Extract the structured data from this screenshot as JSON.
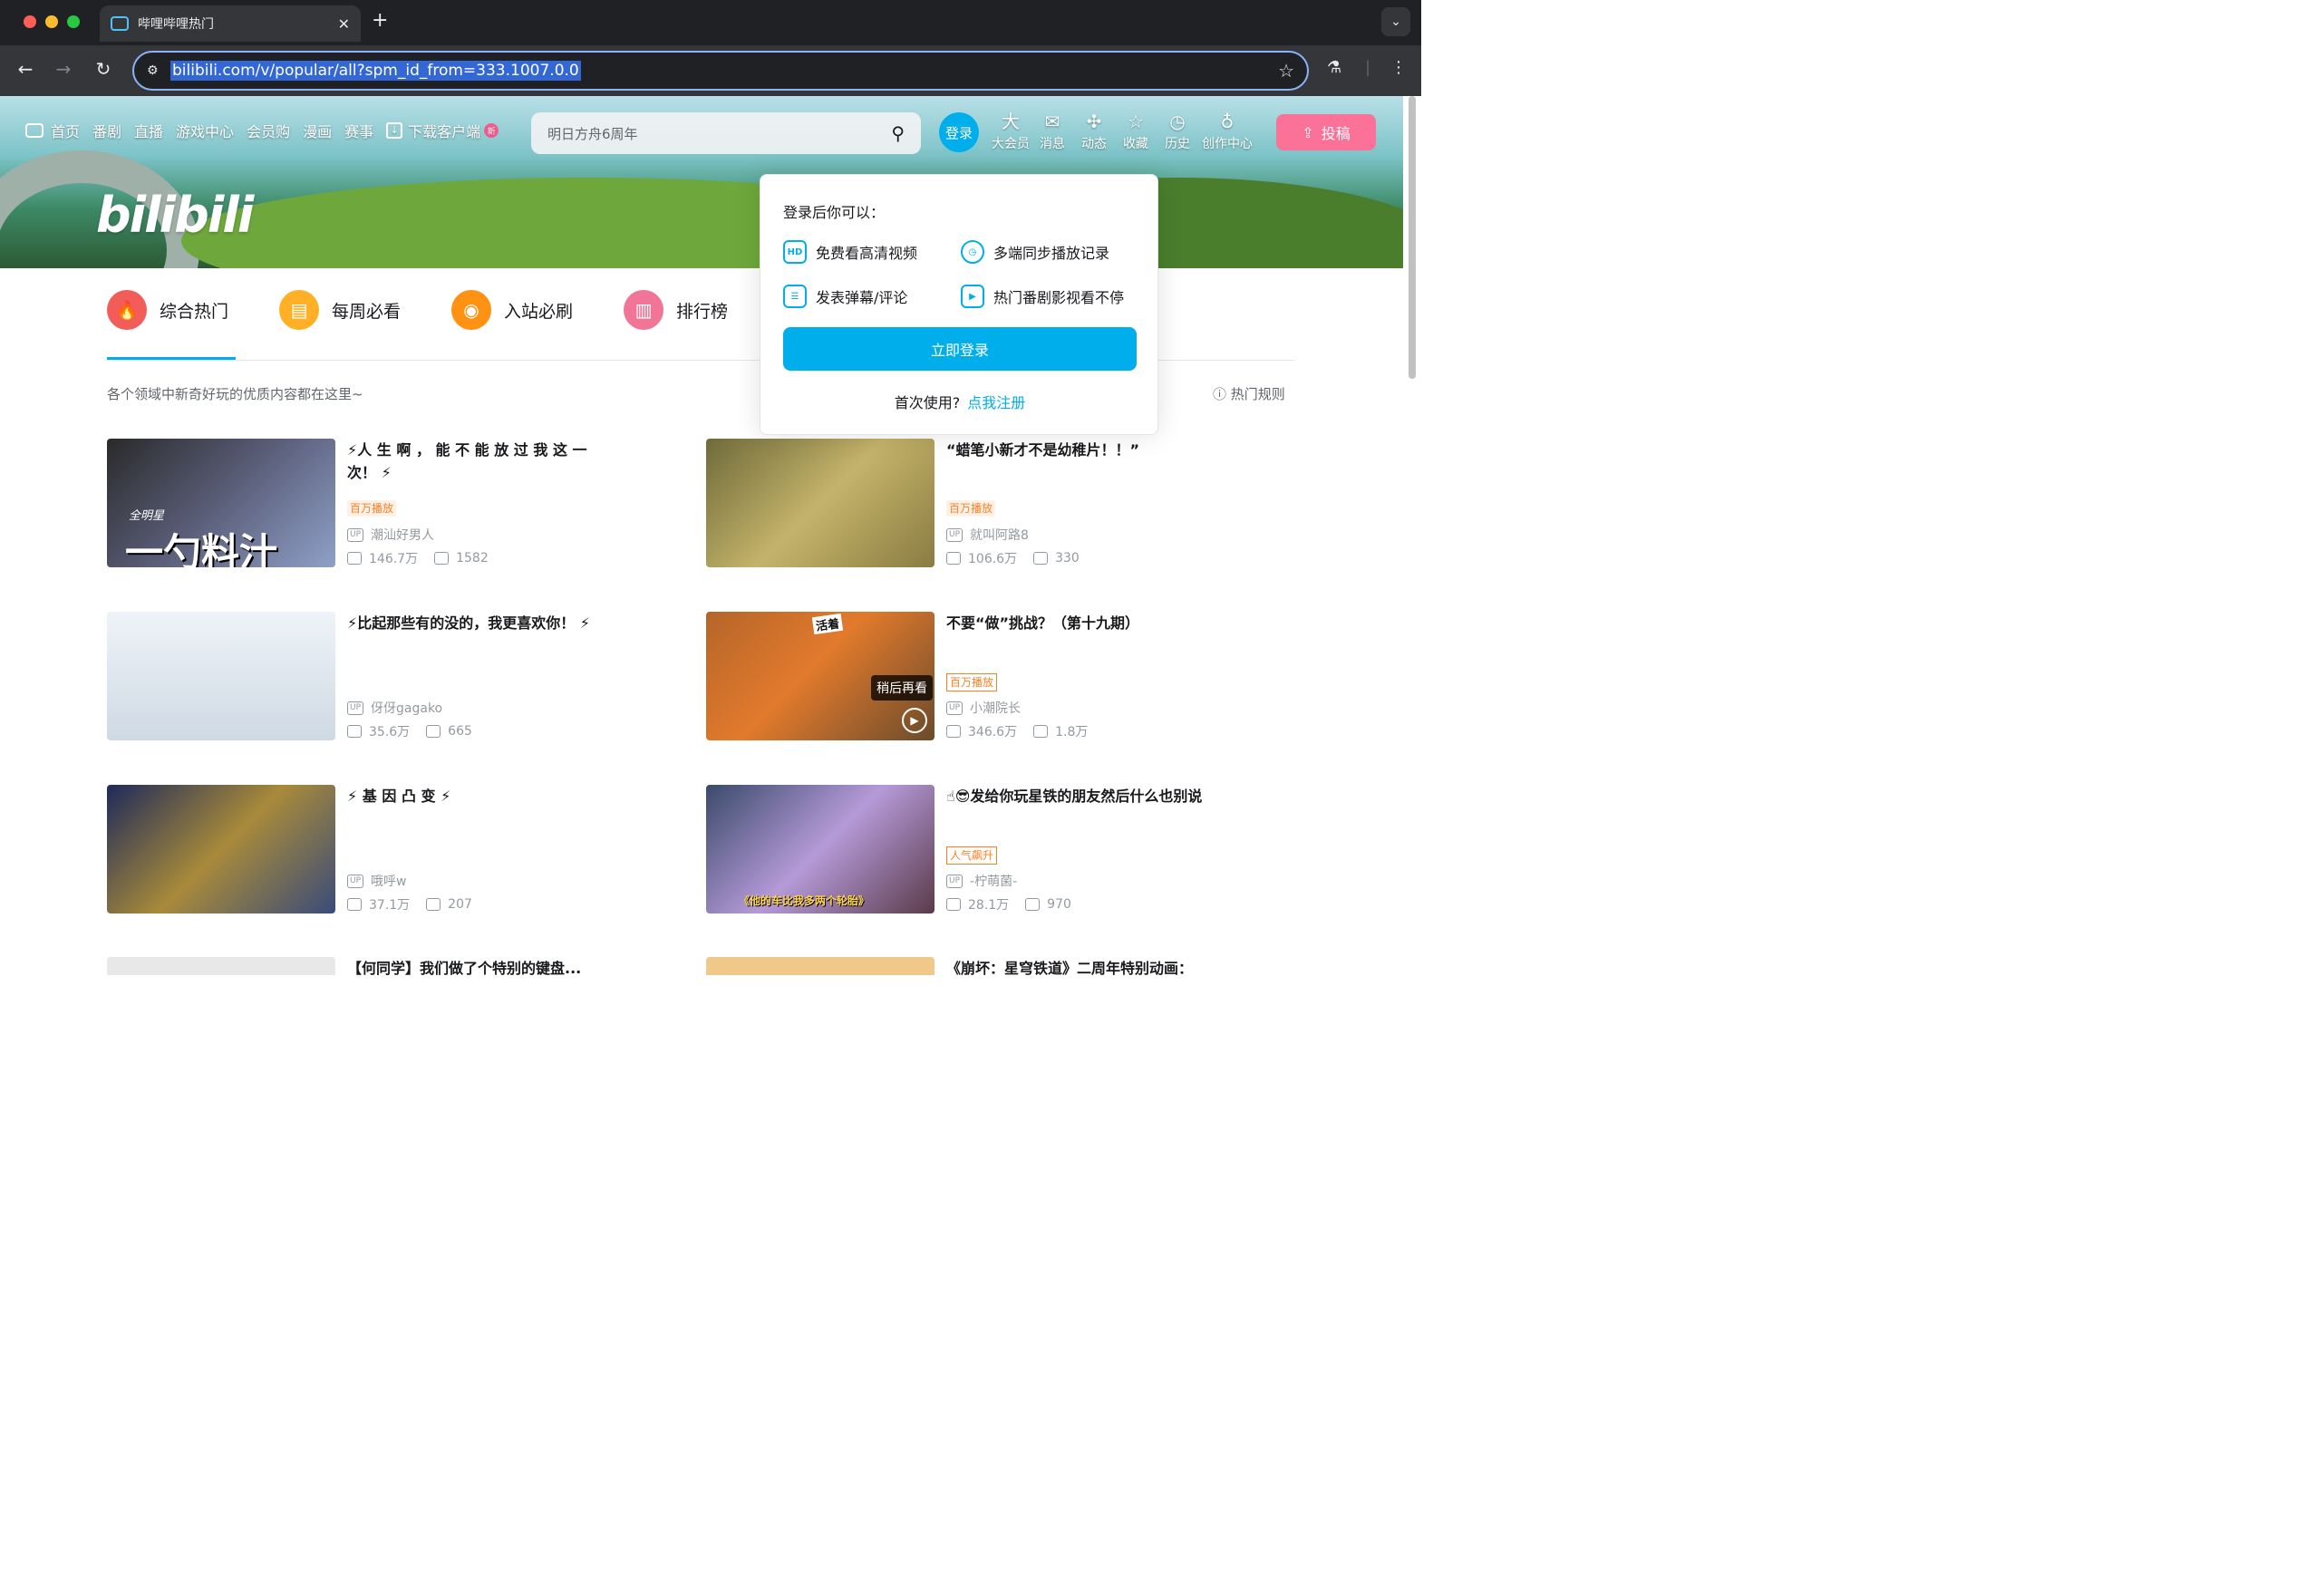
{
  "browser": {
    "tab_title": "哔哩哔哩热门",
    "url": "bilibili.com/v/popular/all?spm_id_from=333.1007.0.0",
    "new_tab": "+",
    "close": "✕",
    "tab_menu": "⌄"
  },
  "header": {
    "logo": "bilibili",
    "nav": [
      "首页",
      "番剧",
      "直播",
      "游戏中心",
      "会员购",
      "漫画",
      "赛事"
    ],
    "download": "下载客户端",
    "new_badge": "新",
    "search_placeholder": "明日方舟6周年",
    "login": "登录",
    "right_nav": [
      {
        "icon": "大",
        "label": "大会员"
      },
      {
        "icon": "✉",
        "label": "消息"
      },
      {
        "icon": "✣",
        "label": "动态"
      },
      {
        "icon": "☆",
        "label": "收藏"
      },
      {
        "icon": "◷",
        "label": "历史"
      },
      {
        "icon": "♁",
        "label": "创作中心"
      }
    ],
    "upload": "投稿"
  },
  "categories": [
    {
      "label": "综合热门",
      "color": "#f25d59",
      "icon": "🔥"
    },
    {
      "label": "每周必看",
      "color": "#ffb027",
      "icon": "▤"
    },
    {
      "label": "入站必刷",
      "color": "#ff9212",
      "icon": "◉"
    },
    {
      "label": "排行榜",
      "color": "#f07597",
      "icon": "▥"
    }
  ],
  "subtitle": "各个领域中新奇好玩的优质内容都在这里~",
  "rules": "热门规则",
  "videos": [
    {
      "title": "⚡人 生 啊 ， 能 不 能 放 过 我 这 一 次！ ⚡",
      "badge": "百万播放",
      "up": "潮汕好男人",
      "views": "146.7万",
      "danmaku": "1582",
      "thumb_text": "一勺料汁",
      "thumb_small": "全明星"
    },
    {
      "title": "“蜡笔小新才不是幼稚片！！”",
      "badge": "百万播放",
      "up": "就叫阿路8",
      "views": "106.6万",
      "danmaku": "330"
    },
    {
      "title": "⚡比起那些有的没的，我更喜欢你！ ⚡",
      "badge": "",
      "up": "伢伢gagako",
      "views": "35.6万",
      "danmaku": "665"
    },
    {
      "title": "不要“做”挑战？（第十九期）",
      "badge": "百万播放",
      "up": "小潮院长",
      "views": "346.6万",
      "danmaku": "1.8万",
      "watch_later": "稍后再看",
      "thumb_tag": "活着"
    },
    {
      "title": "⚡ 基 因 凸 变 ⚡",
      "badge": "",
      "up": "哦呼w",
      "views": "37.1万",
      "danmaku": "207"
    },
    {
      "title": "☝😎发给你玩星铁的朋友然后什么也别说",
      "badge": "人气飙升",
      "up": "-柠萌菌-",
      "views": "28.1万",
      "danmaku": "970",
      "thumb_caption": "《他的车比我多两个轮胎》"
    },
    {
      "title": "【何同学】我们做了个特别的键盘...",
      "badge": "",
      "up": "",
      "views": "",
      "danmaku": ""
    },
    {
      "title": "《崩坏：星穹铁道》二周年特别动画：",
      "badge": "",
      "up": "",
      "views": "",
      "danmaku": ""
    }
  ],
  "popover": {
    "heading": "登录后你可以：",
    "features": [
      {
        "icon": "HD",
        "label": "免费看高清视频"
      },
      {
        "icon": "◷",
        "label": "多端同步播放记录"
      },
      {
        "icon": "☰",
        "label": "发表弹幕/评论"
      },
      {
        "icon": "▶",
        "label": "热门番剧影视看不停"
      }
    ],
    "login_button": "立即登录",
    "first_time": "首次使用?",
    "register": "点我注册"
  }
}
